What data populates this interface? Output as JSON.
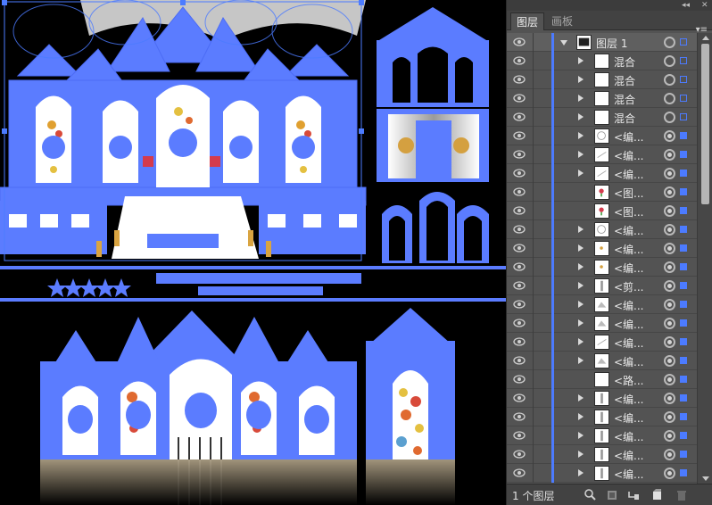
{
  "panel": {
    "collapse_control": "◂◂",
    "close_control": "✕",
    "tabs": [
      {
        "label": "图层",
        "active": true
      },
      {
        "label": "画板",
        "active": false
      }
    ],
    "menu_icon": "panel-menu-icon"
  },
  "layers": [
    {
      "label": "图层 1",
      "kind": "top",
      "expanded": true,
      "selected": true,
      "target": "hollow",
      "selbox": "hollow"
    },
    {
      "label": "混合",
      "kind": "group",
      "target": "hollow",
      "selbox": "hollow"
    },
    {
      "label": "混合",
      "kind": "group",
      "target": "hollow",
      "selbox": "hollow"
    },
    {
      "label": "混合",
      "kind": "group",
      "target": "hollow",
      "selbox": "hollow"
    },
    {
      "label": "混合",
      "kind": "group",
      "target": "hollow",
      "selbox": "hollow"
    },
    {
      "label": "<编...",
      "kind": "group",
      "target": "filled",
      "selbox": "filled"
    },
    {
      "label": "<编...",
      "kind": "group",
      "target": "filled",
      "selbox": "filled"
    },
    {
      "label": "<编...",
      "kind": "group",
      "target": "filled",
      "selbox": "filled"
    },
    {
      "label": "<图...",
      "kind": "item",
      "target": "filled",
      "selbox": "filled"
    },
    {
      "label": "<图...",
      "kind": "item",
      "target": "filled",
      "selbox": "filled"
    },
    {
      "label": "<编...",
      "kind": "group",
      "target": "filled",
      "selbox": "filled"
    },
    {
      "label": "<编...",
      "kind": "group",
      "target": "filled",
      "selbox": "filled"
    },
    {
      "label": "<编...",
      "kind": "group",
      "target": "filled",
      "selbox": "filled"
    },
    {
      "label": "<剪...",
      "kind": "group",
      "target": "filled",
      "selbox": "filled"
    },
    {
      "label": "<编...",
      "kind": "group",
      "target": "filled",
      "selbox": "filled"
    },
    {
      "label": "<编...",
      "kind": "group",
      "target": "filled",
      "selbox": "filled"
    },
    {
      "label": "<编...",
      "kind": "group",
      "target": "filled",
      "selbox": "filled"
    },
    {
      "label": "<编...",
      "kind": "group",
      "target": "filled",
      "selbox": "filled"
    },
    {
      "label": "<路...",
      "kind": "item",
      "target": "filled",
      "selbox": "filled"
    },
    {
      "label": "<编...",
      "kind": "group",
      "target": "filled",
      "selbox": "filled"
    },
    {
      "label": "<编...",
      "kind": "group",
      "target": "filled",
      "selbox": "filled"
    },
    {
      "label": "<编...",
      "kind": "group",
      "target": "filled",
      "selbox": "filled"
    },
    {
      "label": "<编...",
      "kind": "group",
      "target": "filled",
      "selbox": "filled"
    },
    {
      "label": "<编...",
      "kind": "group",
      "target": "filled",
      "selbox": "filled"
    }
  ],
  "footer": {
    "layer_count": "1 个图层",
    "icons": [
      "locate-object-icon",
      "make-clipping-mask-icon",
      "create-sublayer-icon",
      "create-new-layer-icon",
      "delete-layer-icon"
    ]
  },
  "colors": {
    "selection": "#4c7bff",
    "panel_bg": "#535353",
    "canvas_bg": "#000000"
  }
}
